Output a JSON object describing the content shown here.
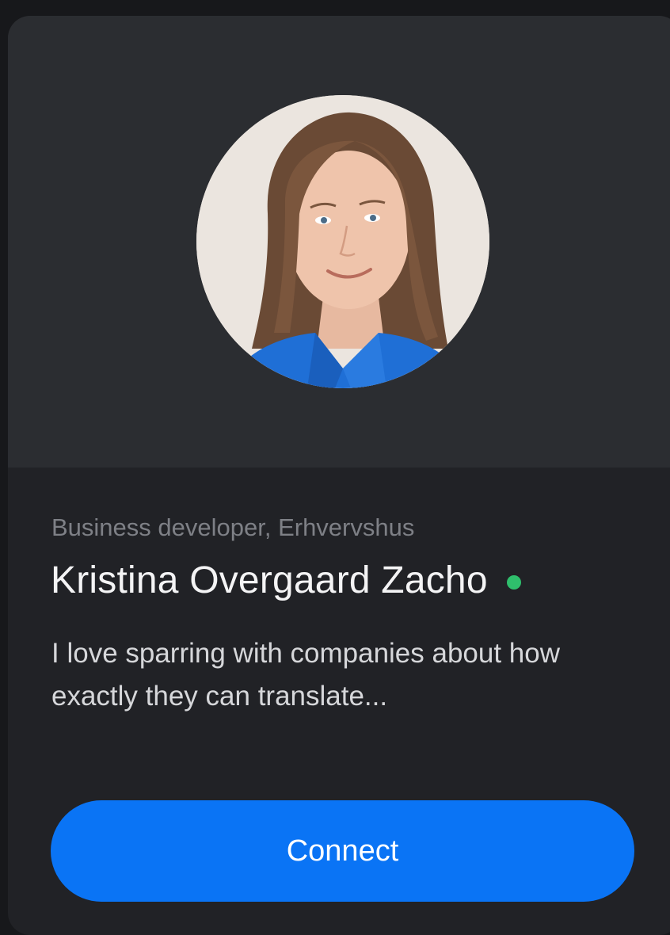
{
  "profile_card": {
    "role": "Business developer, Erhvervshus",
    "name": "Kristina Overgaard Zacho",
    "online": true,
    "bio": "I love sparring with companies about how exactly they can translate...",
    "connect_label": "Connect"
  },
  "colors": {
    "page_background": "#17181b",
    "card_background": "#212226",
    "header_background": "#2b2d31",
    "accent_button": "#0a74f5",
    "online_indicator": "#2fbf6c",
    "muted_text": "#7e8086"
  },
  "icons": {
    "status": "online-status-dot"
  }
}
